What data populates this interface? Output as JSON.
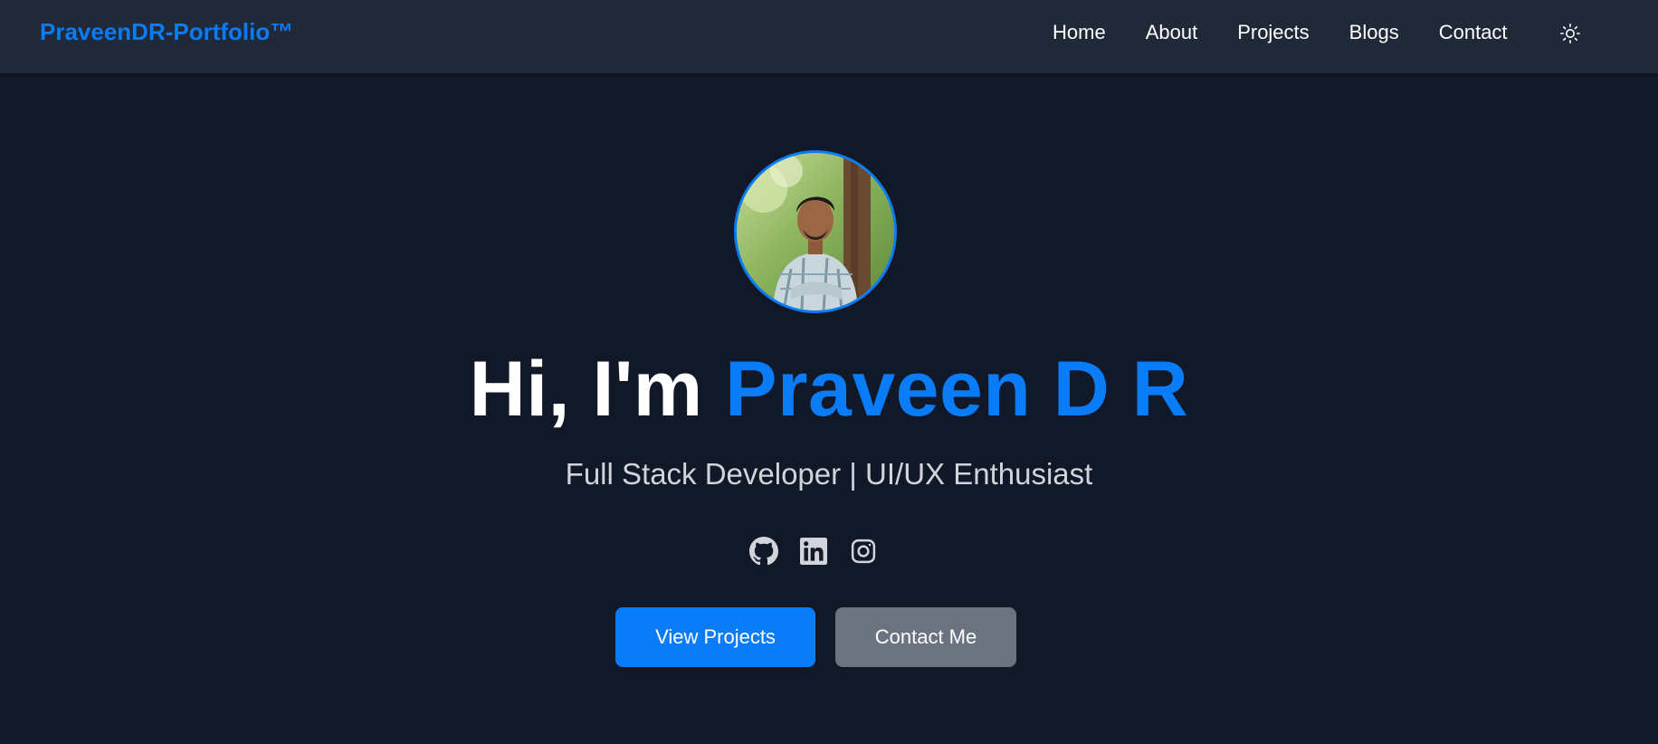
{
  "nav": {
    "brand": "PraveenDR-Portfolio™",
    "links": [
      "Home",
      "About",
      "Projects",
      "Blogs",
      "Contact"
    ],
    "theme_toggle_icon": "sun-icon"
  },
  "hero": {
    "greeting": "Hi, I'm ",
    "name": "Praveen D R",
    "subtitle": "Full Stack Developer | UI/UX Enthusiast",
    "social_icons": [
      "github-icon",
      "linkedin-icon",
      "instagram-icon"
    ],
    "primary_button": "View Projects",
    "secondary_button": "Contact Me"
  },
  "colors": {
    "accent": "#0a7cf7",
    "background": "#111827",
    "navbar": "#1f2937",
    "secondary_button": "#6b7280"
  }
}
